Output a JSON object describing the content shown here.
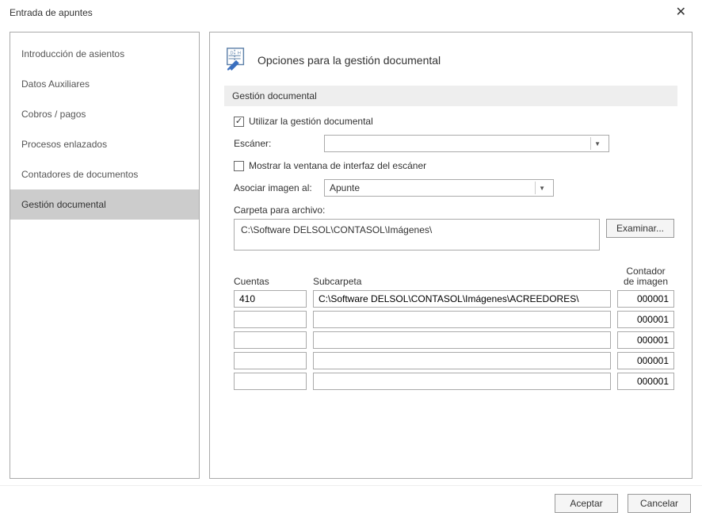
{
  "window": {
    "title": "Entrada de apuntes"
  },
  "sidebar": {
    "items": [
      {
        "label": "Introducción de asientos"
      },
      {
        "label": "Datos Auxiliares"
      },
      {
        "label": "Cobros / pagos"
      },
      {
        "label": "Procesos enlazados"
      },
      {
        "label": "Contadores de documentos"
      },
      {
        "label": "Gestión documental"
      }
    ]
  },
  "content": {
    "heading": "Opciones para la gestión documental",
    "section": "Gestión documental",
    "use_doc_mgmt": "Utilizar la gestión documental",
    "scanner_label": "Escáner:",
    "scanner_value": "",
    "show_interface": "Mostrar la ventana de interfaz del escáner",
    "associate_label": "Asociar imagen al:",
    "associate_value": "Apunte",
    "folder_label": "Carpeta para archivo:",
    "folder_value": "C:\\Software DELSOL\\CONTASOL\\Imágenes\\",
    "browse": "Examinar..."
  },
  "table": {
    "headers": {
      "cuentas": "Cuentas",
      "subcarpeta": "Subcarpeta",
      "contador_l1": "Contador",
      "contador_l2": "de imagen"
    },
    "rows": [
      {
        "cuenta": "410",
        "sub": "C:\\Software DELSOL\\CONTASOL\\Imágenes\\ACREEDORES\\",
        "contador": "000001"
      },
      {
        "cuenta": "",
        "sub": "",
        "contador": "000001"
      },
      {
        "cuenta": "",
        "sub": "",
        "contador": "000001"
      },
      {
        "cuenta": "",
        "sub": "",
        "contador": "000001"
      },
      {
        "cuenta": "",
        "sub": "",
        "contador": "000001"
      }
    ]
  },
  "footer": {
    "accept": "Aceptar",
    "cancel": "Cancelar"
  }
}
